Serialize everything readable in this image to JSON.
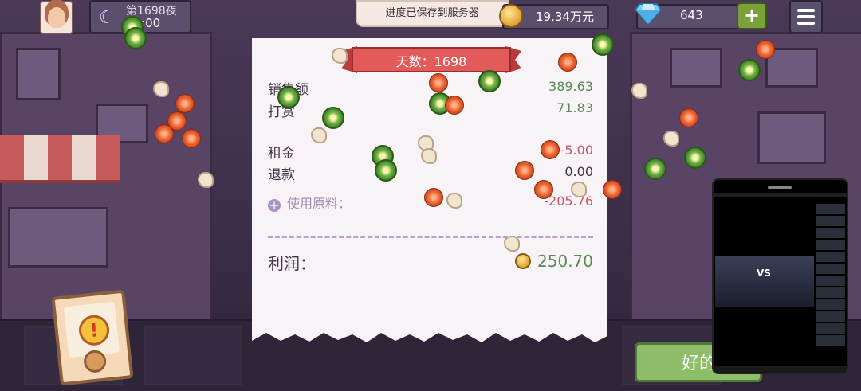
{
  "hud": {
    "night_label": "第1698夜",
    "time": "10:00",
    "save_toast": "进度已保存到服务器",
    "money": "19.34万元",
    "gems": "643",
    "plus_label": "+"
  },
  "receipt": {
    "day_banner": "天数：1698",
    "rows": [
      {
        "label": "销售额",
        "value": "389.63"
      },
      {
        "label": "打赏",
        "value": "71.83"
      },
      {
        "label": "租金",
        "value": "-5.00"
      },
      {
        "label": "退款",
        "value": "0.00"
      }
    ],
    "ingredients_label": "使用原料：",
    "ingredients_value": "-205.76",
    "profit_label": "利润：",
    "profit_value": "250.70"
  },
  "ok_button": "好的",
  "pip": {
    "vs_text": "VS"
  },
  "colors": {
    "positive": "#5c8a54",
    "negative": "#c4566a",
    "banner": "#e35a5a",
    "ok_button": "#8fbe6a"
  }
}
